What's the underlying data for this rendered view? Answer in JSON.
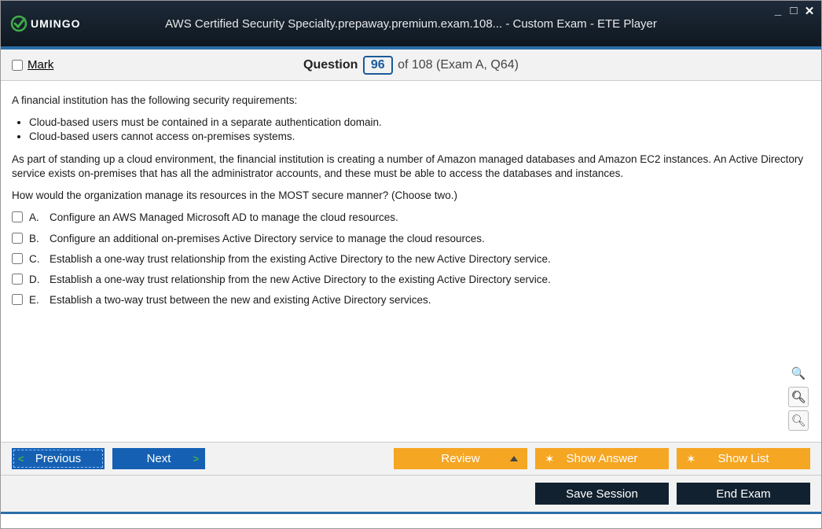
{
  "window": {
    "title": "AWS Certified Security Specialty.prepaway.premium.exam.108... - Custom Exam - ETE Player",
    "brand": "UMINGO"
  },
  "header": {
    "mark_label": "Mark",
    "question_word": "Question",
    "current": "96",
    "total_suffix": "of 108 (Exam A, Q64)"
  },
  "question": {
    "intro": "A financial institution has the following security requirements:",
    "bullets": [
      "Cloud-based users must be contained in a separate authentication domain.",
      "Cloud-based users cannot access on-premises systems."
    ],
    "para2": "As part of standing up a cloud environment, the financial institution is creating a number of Amazon managed databases and Amazon EC2 instances. An Active Directory service exists on-premises that has all the administrator accounts, and these must be able to access the databases and instances.",
    "para3": "How would the organization manage its resources in the MOST secure manner? (Choose two.)"
  },
  "options": [
    {
      "letter": "A.",
      "text": "Configure an AWS Managed Microsoft AD to manage the cloud resources."
    },
    {
      "letter": "B.",
      "text": "Configure an additional on-premises Active Directory service to manage the cloud resources."
    },
    {
      "letter": "C.",
      "text": "Establish a one-way trust relationship from the existing Active Directory to the new Active Directory service."
    },
    {
      "letter": "D.",
      "text": "Establish a one-way trust relationship from the new Active Directory to the existing Active Directory service."
    },
    {
      "letter": "E.",
      "text": "Establish a two-way trust between the new and existing Active Directory services."
    }
  ],
  "nav": {
    "previous": "Previous",
    "next": "Next",
    "review": "Review",
    "show_answer": "Show Answer",
    "show_list": "Show List"
  },
  "bottom": {
    "save_session": "Save Session",
    "end_exam": "End Exam"
  }
}
